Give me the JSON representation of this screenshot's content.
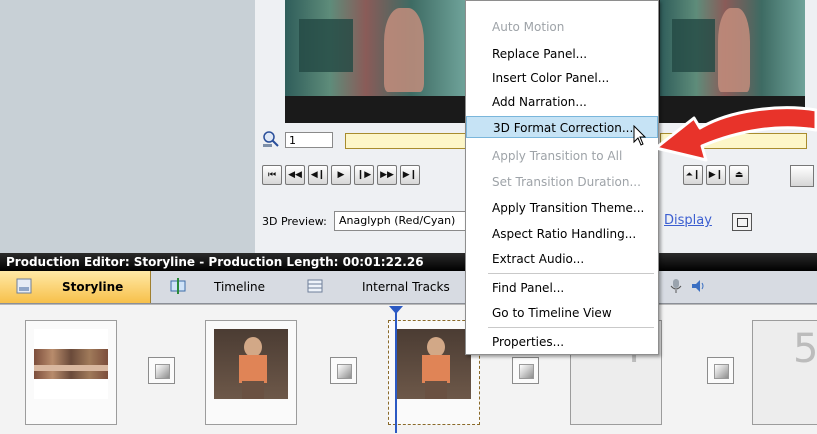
{
  "preview": {
    "frame_value": "1",
    "preview_label": "3D Preview:",
    "preview_mode": "Anaglyph (Red/Cyan)",
    "display_link": "Display"
  },
  "transport": {
    "buttons": [
      "⏮",
      "◀◀",
      "◀❙",
      "▶",
      "❙▶",
      "▶▶",
      "▶❙"
    ],
    "right_buttons": [
      "⏶❙",
      "▶❙",
      "⏏"
    ]
  },
  "editor": {
    "title": "Production Editor: Storyline - Production Length: 00:01:22.26",
    "tabs": {
      "storyline": "Storyline",
      "timeline": "Timeline",
      "internal_tracks": "Internal Tracks"
    }
  },
  "storyline": {
    "cards": [
      {
        "label": ""
      },
      {
        "label": ""
      },
      {
        "label": ""
      },
      {
        "label": "4"
      },
      {
        "label": "5"
      }
    ]
  },
  "context_menu": {
    "items": [
      {
        "label": "Auto Motion",
        "disabled": true
      },
      {
        "label": "Replace Panel...",
        "disabled": false
      },
      {
        "label": "Insert Color Panel...",
        "disabled": false
      },
      {
        "label": "Add Narration...",
        "disabled": false
      },
      {
        "label": "3D Format Correction...",
        "disabled": false,
        "highlighted": true
      },
      {
        "label": "Apply Transition to All",
        "disabled": true
      },
      {
        "label": "Set Transition Duration...",
        "disabled": true
      },
      {
        "label": "Apply Transition Theme...",
        "disabled": false
      },
      {
        "label": "Aspect Ratio Handling...",
        "disabled": false
      },
      {
        "label": "Extract Audio...",
        "disabled": false
      },
      {
        "label": "Find Panel...",
        "disabled": false
      },
      {
        "label": "Go to Timeline View",
        "disabled": false
      },
      {
        "label": "Properties...",
        "disabled": false
      }
    ]
  },
  "colors": {
    "accent_tab": "#f7c04a",
    "menu_highlight": "#c6e3f5",
    "arrow": "#e8332a",
    "playhead": "#2b59c3"
  }
}
